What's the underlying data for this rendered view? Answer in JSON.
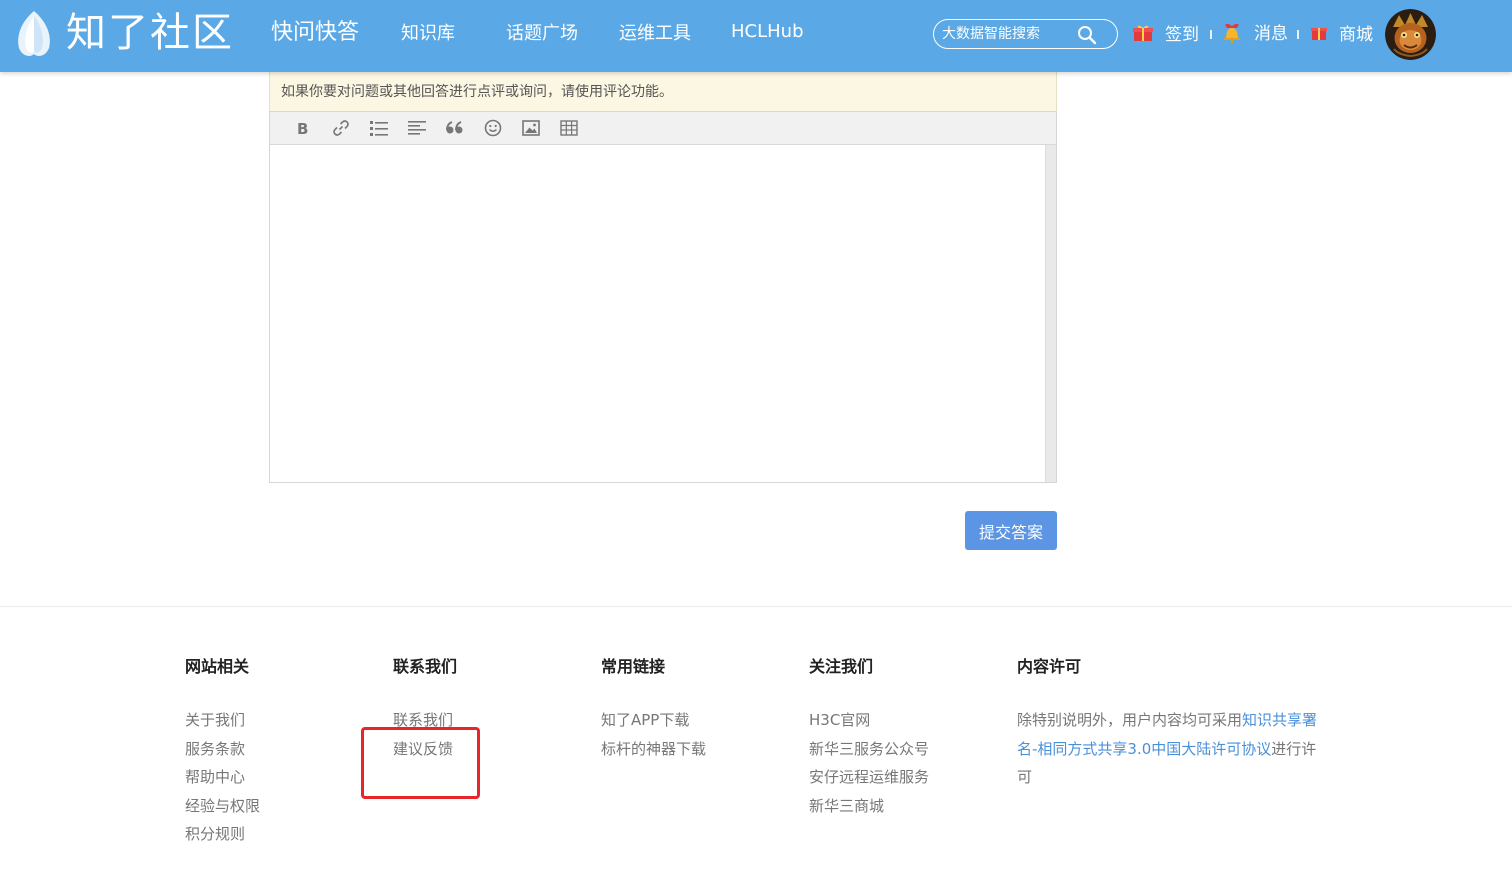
{
  "header": {
    "logo_text": "知了社区",
    "nav": [
      "快问快答",
      "知识库",
      "话题广场",
      "运维工具",
      "HCLHub"
    ],
    "search_placeholder": "大数据智能搜索",
    "checkin_label": "签到",
    "messages_label": "消息",
    "mall_label": "商城"
  },
  "editor": {
    "notice": "如果你要对问题或其他回答进行点评或询问，请使用评论功能。",
    "toolbar": [
      "bold",
      "link",
      "list",
      "align",
      "quote",
      "emoji",
      "image",
      "table"
    ],
    "submit_label": "提交答案"
  },
  "footer": {
    "columns": [
      {
        "title": "网站相关",
        "links": [
          "关于我们",
          "服务条款",
          "帮助中心",
          "经验与权限",
          "积分规则"
        ]
      },
      {
        "title": "联系我们",
        "links": [
          "联系我们",
          "建议反馈"
        ]
      },
      {
        "title": "常用链接",
        "links": [
          "知了APP下载",
          "标杆的神器下载"
        ]
      },
      {
        "title": "关注我们",
        "links": [
          "H3C官网",
          "新华三服务公众号",
          "安仔远程运维服务",
          "新华三商城"
        ]
      }
    ],
    "license": {
      "title": "内容许可",
      "text_before": "除特别说明外，用户内容均可采用",
      "link_text": "知识共享署名-相同方式共享3.0中国大陆许可协议",
      "text_after": "进行许可"
    }
  },
  "colors": {
    "header_bg": "#5aa9e6",
    "submit_bg": "#5b95e4",
    "highlight_border": "#e8262a",
    "license_link": "#4a90d9"
  }
}
